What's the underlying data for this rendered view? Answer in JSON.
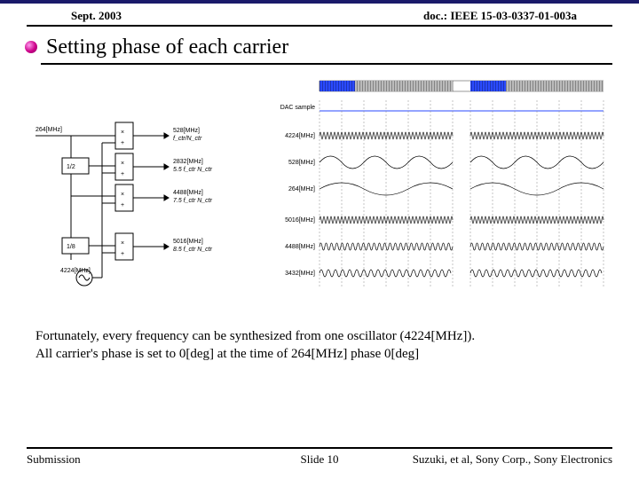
{
  "header": {
    "left": "Sept. 2003",
    "right": "doc.: IEEE 15-03-0337-01-003a"
  },
  "title": "Setting phase of each carrier",
  "body": {
    "line1": "Fortunately, every frequency can be synthesized from one oscillator (4224[MHz]).",
    "line2": "All carrier's phase is set to 0[deg] at the time of 264[MHz] phase 0[deg]"
  },
  "diagram_left": {
    "input_freq": "264[MHz]",
    "dividers": [
      "1/2",
      "1/8"
    ],
    "osc_freq": "4224[MHz]",
    "mult_out": [
      {
        "freq": "528[MHz]",
        "rel": "f_ctr/N_ctr"
      },
      {
        "freq": "2832[MHz]",
        "rel": "5.5 f_ctr N_ctr"
      },
      {
        "freq": "4488[MHz]",
        "rel": "7.5 f_ctr N_ctr"
      },
      {
        "freq": "5016[MHz]",
        "rel": "8.5 f_ctr N_ctr"
      }
    ]
  },
  "diagram_right": {
    "top_label": "DAC sample",
    "traces": [
      "4224[MHz]",
      "528[MHz]",
      "264[MHz]",
      "5016[MHz]",
      "4488[MHz]",
      "3432[MHz]"
    ]
  },
  "footer": {
    "left": "Submission",
    "center": "Slide 10",
    "right": "Suzuki, et al, Sony Corp., Sony Electronics"
  }
}
